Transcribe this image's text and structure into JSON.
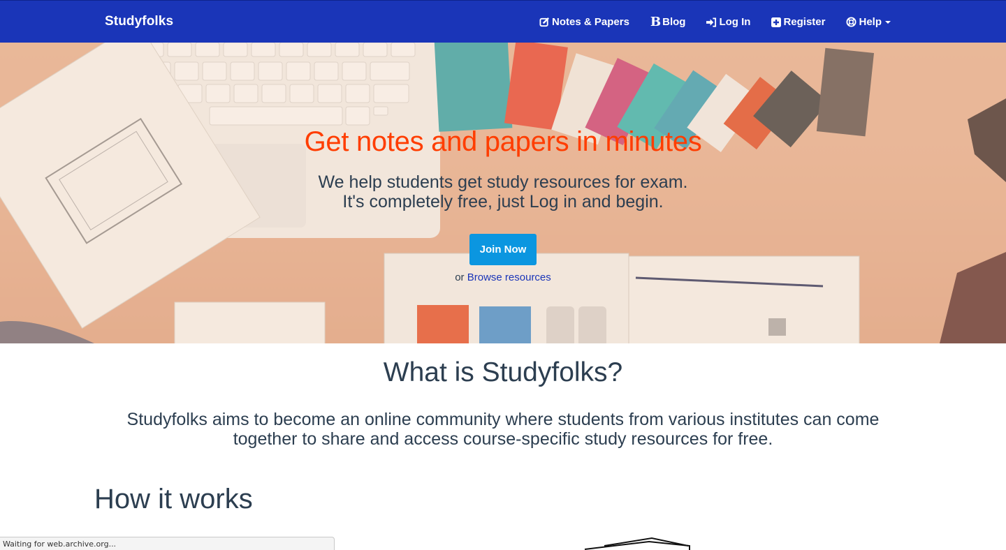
{
  "navbar": {
    "brand": "Studyfolks",
    "items": [
      {
        "label": "Notes & Papers",
        "icon": "edit-icon"
      },
      {
        "label": "Blog",
        "icon": "blogger-icon"
      },
      {
        "label": "Log In",
        "icon": "sign-in-icon"
      },
      {
        "label": "Register",
        "icon": "plus-square-icon"
      },
      {
        "label": "Help",
        "icon": "life-ring-icon"
      }
    ]
  },
  "hero": {
    "title": "Get notes and papers in minutes",
    "subtitle_line1": "We help students get study resources for exam.",
    "subtitle_line2": "It's completely free, just Log in and begin.",
    "join_button": "Join Now",
    "browse_prefix": "or",
    "browse_link": "Browse resources"
  },
  "about": {
    "title": "What is Studyfolks?",
    "text": "Studyfolks aims to become an online community where students from various institutes can come together to share and access course-specific study resources for free."
  },
  "how": {
    "title": "How it works"
  },
  "status": {
    "text": "Waiting for web.archive.org..."
  },
  "colors": {
    "navbar": "#1a35b8",
    "hero_title": "#ff3d00",
    "button": "#0b96e0",
    "text": "#2c3e50"
  }
}
